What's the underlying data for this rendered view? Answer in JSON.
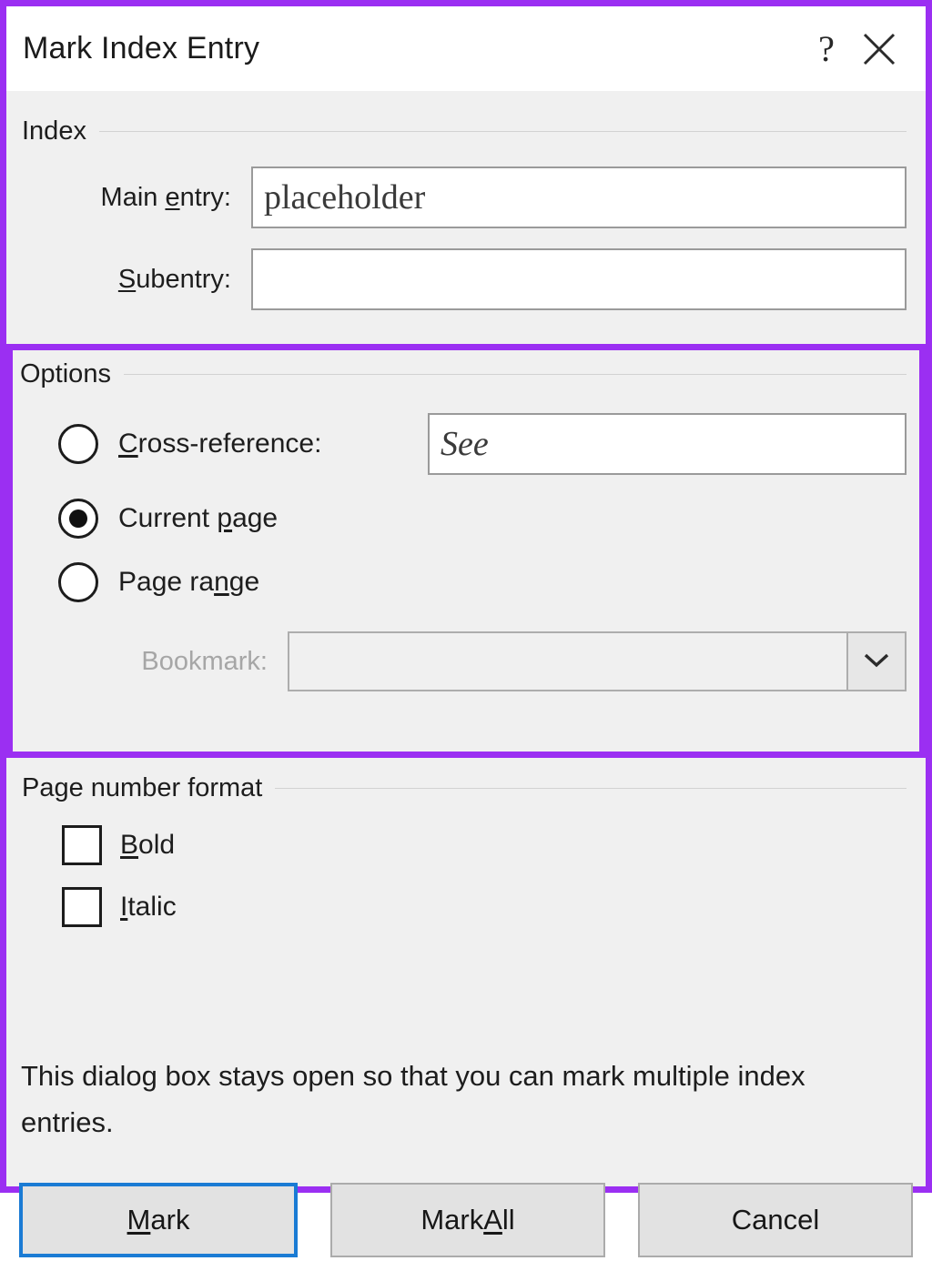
{
  "dialog": {
    "title": "Mark Index Entry",
    "accent_highlight_color": "#9B2FF2",
    "focus_border_color": "#1A7BD4",
    "help_icon": "question-mark-help-icon",
    "close_icon": "close-x-icon"
  },
  "index_group": {
    "label": "Index",
    "main_entry": {
      "label_before": "Main ",
      "label_accel": "e",
      "label_after": "ntry:",
      "value": "placeholder",
      "placeholder": ""
    },
    "subentry": {
      "label_accel": "S",
      "label_after": "ubentry:",
      "value": "",
      "placeholder": ""
    }
  },
  "options_group": {
    "label": "Options",
    "cross_reference": {
      "label_accel": "C",
      "label_after": "ross-reference:",
      "selected": false,
      "value": "See",
      "placeholder": ""
    },
    "current_page": {
      "label_before": "Current ",
      "label_accel": "p",
      "label_after": "age",
      "selected": true
    },
    "page_range": {
      "label_before": "Page ra",
      "label_accel": "n",
      "label_after": "ge",
      "selected": false
    },
    "bookmark": {
      "label": "Bookmark:",
      "value": "",
      "disabled": true,
      "dropdown_icon": "chevron-down-icon",
      "disabled_label_color": "#A6A6A6"
    }
  },
  "page_number_format_group": {
    "label": "Page number format",
    "bold": {
      "label_accel": "B",
      "label_after": "old",
      "checked": false
    },
    "italic": {
      "label_accel": "I",
      "label_after": "talic",
      "checked": false
    }
  },
  "note": {
    "text": "This dialog box stays open so that you can mark multiple index entries."
  },
  "buttons": {
    "mark": {
      "label_accel": "M",
      "label_after": "ark",
      "focused": true
    },
    "mark_all": {
      "label_before": "Mark ",
      "label_accel": "A",
      "label_after": "ll",
      "focused": false
    },
    "cancel": {
      "label": "Cancel",
      "focused": false
    }
  }
}
